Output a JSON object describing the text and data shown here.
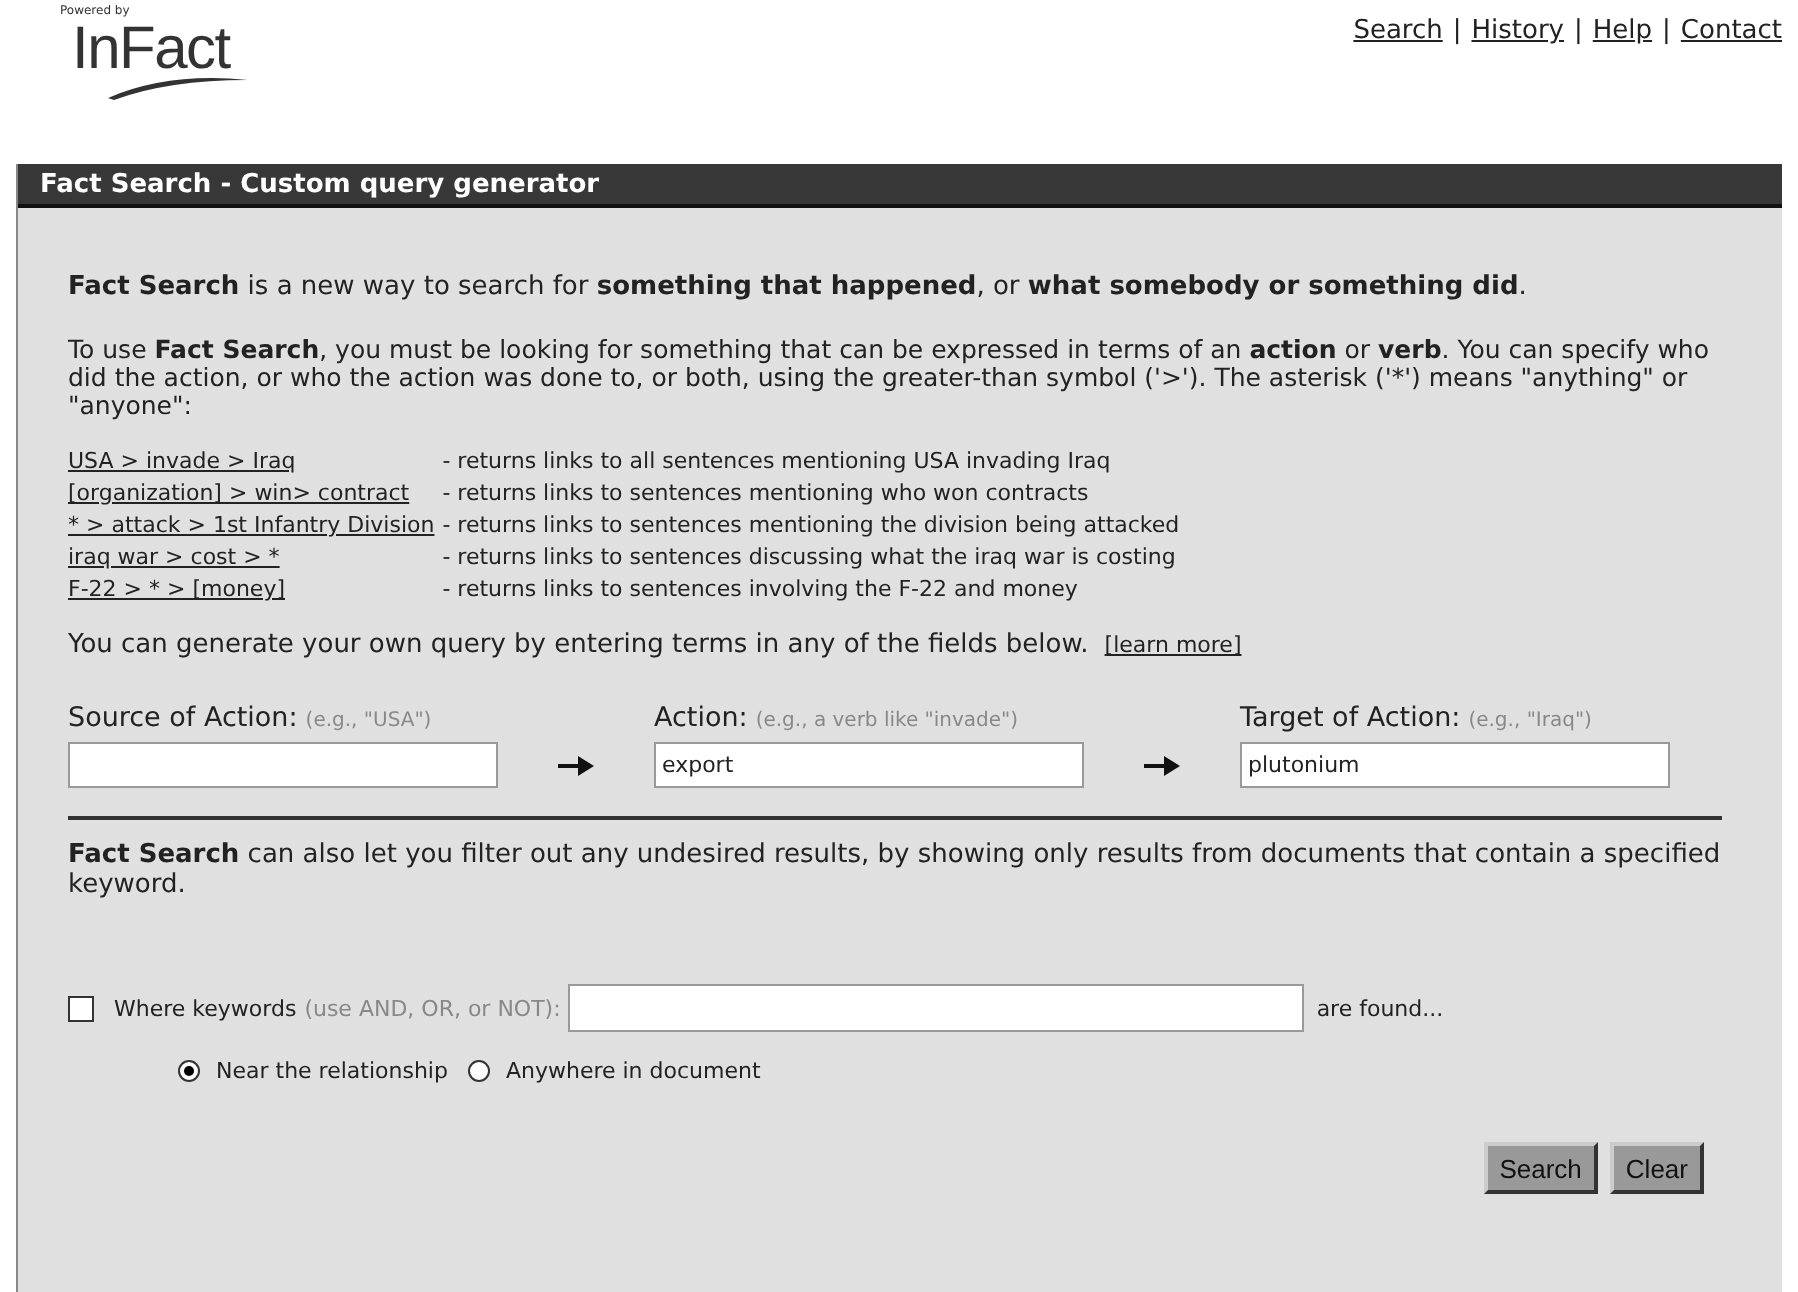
{
  "logo": {
    "tagline": "Powered by",
    "name": "InFact"
  },
  "nav": [
    {
      "label": "Search"
    },
    {
      "separator": "|",
      "label": "History"
    },
    {
      "separator": "|",
      "label": "Help"
    },
    {
      "separator": "|",
      "label": "Contact"
    }
  ],
  "panel": {
    "title": "Fact Search - Custom query generator"
  },
  "intro": "**Fact Search** is a new way to search for **something that happened**, or **what somebody or something did**.",
  "usage": "To use **Fact Search**, you must be looking for something that can be expressed in terms of an **action** or **verb**. You can specify who did the action, or who the action was done to, or both, using the greater-than symbol ('>'). The asterisk ('*') means \"anything\" or \"anyone\":",
  "examples": [
    {
      "query": "USA > invade > Iraq",
      "description": "- returns links to all sentences mentioning USA invading Iraq"
    },
    {
      "query": "[organization] > win> contract",
      "description": "- returns links to sentences mentioning who won contracts"
    },
    {
      "query": "* > attack > 1st Infantry Division",
      "description": "- returns links to sentences mentioning the division being attacked"
    },
    {
      "query": "iraq war > cost > *",
      "description": "- returns links to sentences discussing what the iraq war is costing"
    },
    {
      "query": "F-22 > * > [money]",
      "description": "- returns links to sentences involving the F-22 and money"
    }
  ],
  "generate_note": "You can generate your own query by entering terms in any of the fields below.",
  "learn_more": "[learn more]",
  "fields": [
    {
      "label": "Source of Action:",
      "hint": "(e.g., \"USA\")"
    },
    {
      "label": "Action:",
      "hint": "(e.g., a verb like \"invade\")",
      "value": "export"
    },
    {
      "label": "Target of Action:",
      "hint": "(e.g., \"Iraq\")",
      "value": "plutonium"
    }
  ],
  "filter_note": "**Fact Search** can also let you filter out any undesired results, by showing only results from documents that contain a specified keyword.",
  "keywords": {
    "checked": false,
    "label": "Where keywords",
    "hint": "(use AND, OR, or NOT):",
    "suffix": "are found..."
  },
  "scope_options": [
    {
      "label": "Near the relationship",
      "selected": true
    },
    {
      "label": "Anywhere in document",
      "selected": false
    }
  ],
  "buttons": [
    "Search",
    "Clear"
  ]
}
